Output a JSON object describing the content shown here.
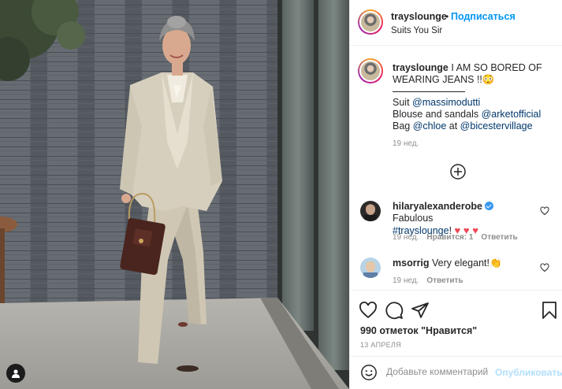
{
  "post": {
    "author": "trayslounge",
    "follow_dot": "•",
    "follow_label": "Подписаться",
    "location": "Suits You Sir"
  },
  "caption": {
    "username": "trayslounge",
    "line1_text": " I AM SO BORED OF",
    "line2_text": "WEARING JEANS !!",
    "line2_emoji": "😳",
    "suit_label": "Suit ",
    "suit_mention": "@massimodutti",
    "blouse_label": "Blouse and sandals ",
    "blouse_mention": "@arketofficial",
    "bag_label": "Bag ",
    "bag_mention": "@chloe",
    "bag_at": " at ",
    "bag_mention2": "@bicestervillage",
    "time": "19 нед."
  },
  "comments": [
    {
      "username": "hilaryalexanderobe",
      "text": " Fabulous",
      "hashtag": "#trayslounge",
      "hashtag_suffix": "!",
      "hearts": "♥ ♥ ♥",
      "time": "19 нед.",
      "likes": "Нравится: 1",
      "reply": "Ответить"
    },
    {
      "username": "msorrig",
      "text": " Very elegant!",
      "emoji": "👏",
      "time": "19 нед.",
      "reply": "Ответить"
    }
  ],
  "likes_text": "990 отметок \"Нравится\"",
  "date": "13 АПРЕЛЯ",
  "comment_input": {
    "placeholder": "Добавьте комментарий...",
    "publish_label": "Опубликовать"
  },
  "icons": {
    "heart": "heart-icon",
    "comment": "comment-icon",
    "share": "share-icon",
    "bookmark": "bookmark-icon",
    "emoji": "emoji-icon",
    "load_more": "plus-circle-icon",
    "user_tag": "user-tag-icon"
  },
  "colors": {
    "link": "#0095f6",
    "mention": "#00376b",
    "muted": "#8e8e8e",
    "heart_red": "#ed4956",
    "verified": "#3897f0"
  }
}
